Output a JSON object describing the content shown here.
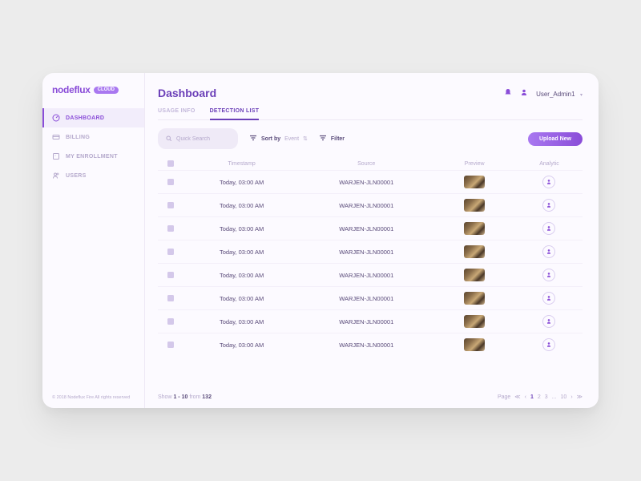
{
  "brand": {
    "name": "nodeflux",
    "badge": "CLOUD"
  },
  "sidebar": {
    "items": [
      {
        "label": "DASHBOARD",
        "icon": "dashboard-icon"
      },
      {
        "label": "BILLING",
        "icon": "billing-icon"
      },
      {
        "label": "MY ENROLLMENT",
        "icon": "enrollment-icon"
      },
      {
        "label": "USERS",
        "icon": "users-icon"
      }
    ]
  },
  "copyright": "© 2018 Nodeflux Fire All rights reserved",
  "header": {
    "title": "Dashboard",
    "user": "User_Admin1"
  },
  "tabs": [
    {
      "label": "USAGE INFO"
    },
    {
      "label": "DETECTION LIST"
    }
  ],
  "toolbar": {
    "search_placeholder": "Quick Search",
    "sort_label": "Sort by",
    "sort_value": "Event",
    "filter_label": "Filter",
    "upload_label": "Upload New"
  },
  "table": {
    "headers": {
      "timestamp": "Timestamp",
      "source": "Source",
      "preview": "Preview",
      "analytic": "Analytic"
    },
    "rows": [
      {
        "timestamp": "Today, 03:00 AM",
        "source": "WARJEN-JLN00001"
      },
      {
        "timestamp": "Today, 03:00 AM",
        "source": "WARJEN-JLN00001"
      },
      {
        "timestamp": "Today, 03:00 AM",
        "source": "WARJEN-JLN00001"
      },
      {
        "timestamp": "Today, 03:00 AM",
        "source": "WARJEN-JLN00001"
      },
      {
        "timestamp": "Today, 03:00 AM",
        "source": "WARJEN-JLN00001"
      },
      {
        "timestamp": "Today, 03:00 AM",
        "source": "WARJEN-JLN00001"
      },
      {
        "timestamp": "Today, 03:00 AM",
        "source": "WARJEN-JLN00001"
      },
      {
        "timestamp": "Today, 03:00 AM",
        "source": "WARJEN-JLN00001"
      }
    ]
  },
  "footer": {
    "show_prefix": "Show",
    "range": "1 - 10",
    "from_label": "from",
    "total": "132",
    "page_label": "Page",
    "pages": [
      "1",
      "2",
      "3",
      "...",
      "10"
    ]
  }
}
